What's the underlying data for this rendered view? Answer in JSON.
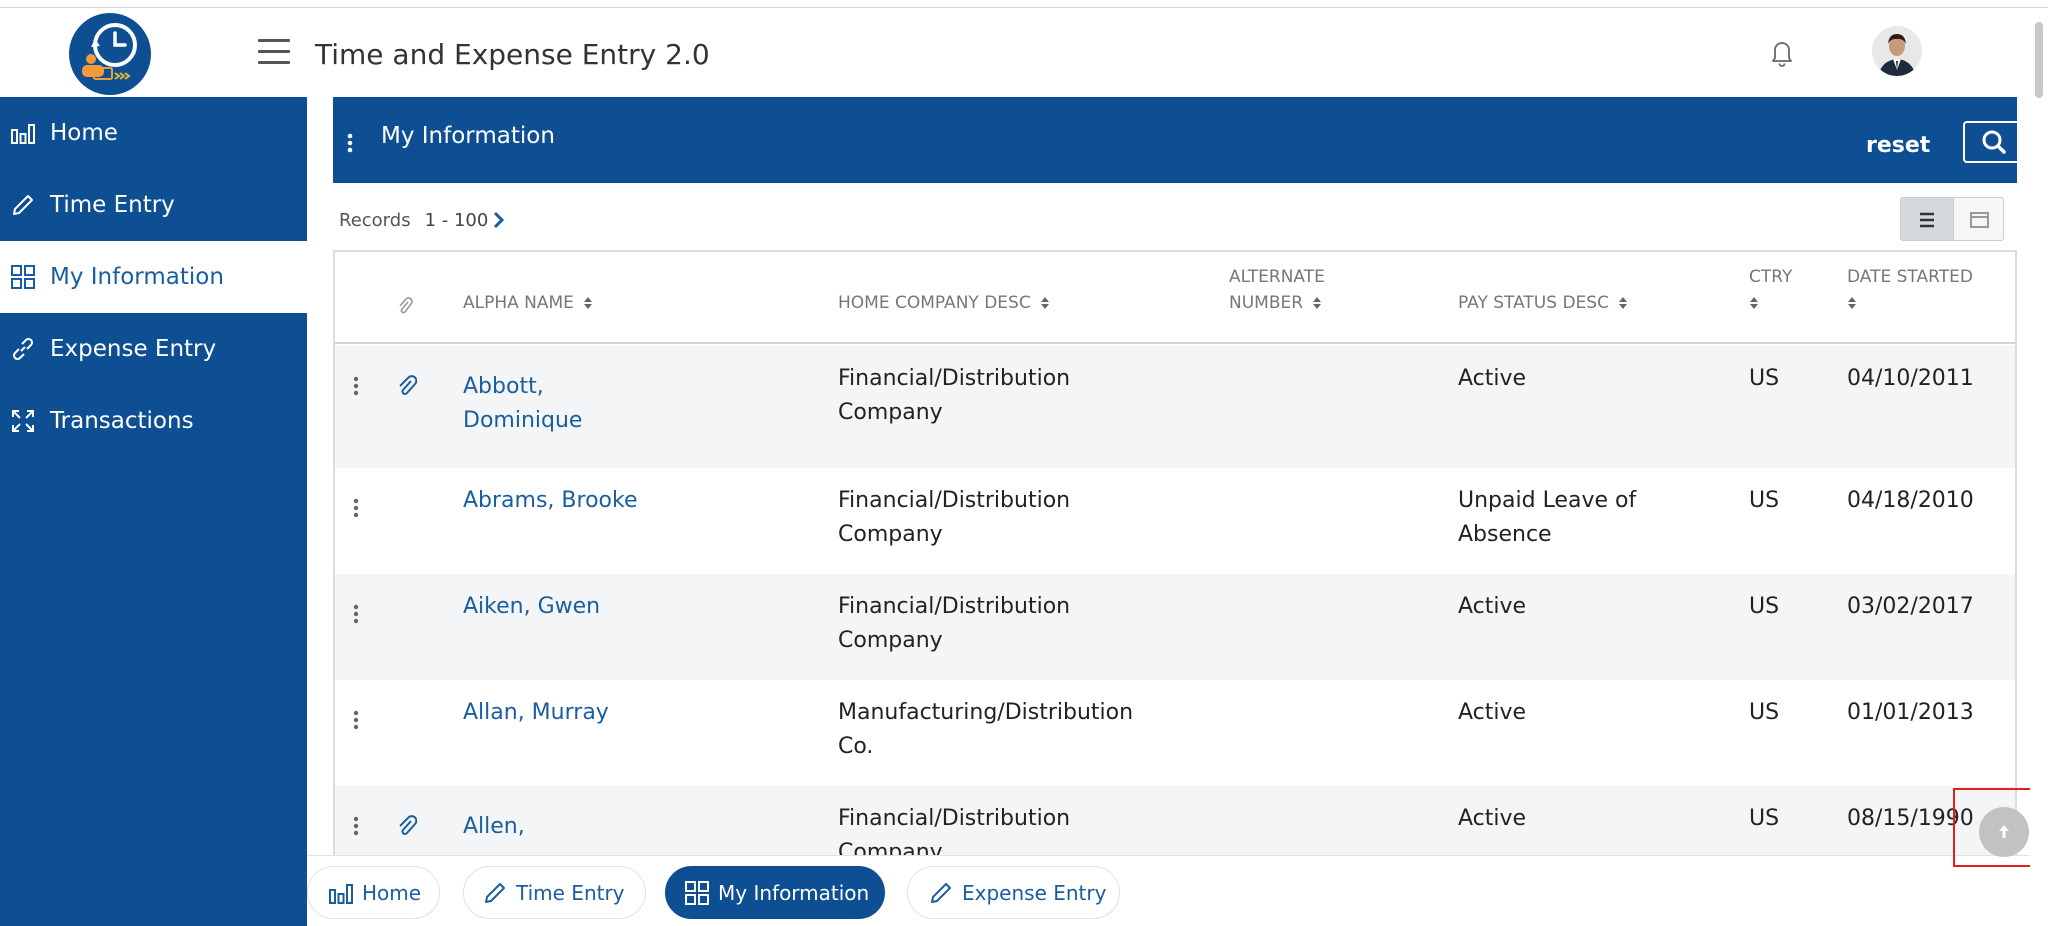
{
  "app": {
    "title": "Time and Expense Entry 2.0"
  },
  "sidebar": {
    "items": [
      {
        "label": "Home",
        "icon": "bar-chart-icon"
      },
      {
        "label": "Time Entry",
        "icon": "pencil-icon"
      },
      {
        "label": "My Information",
        "icon": "grid-icon",
        "active": true
      },
      {
        "label": "Expense Entry",
        "icon": "link-icon"
      },
      {
        "label": "Transactions",
        "icon": "expand-icon"
      }
    ]
  },
  "panel": {
    "title": "My Information",
    "reset_label": "reset",
    "records_label": "Records",
    "records_range": "1 - 100"
  },
  "table": {
    "columns": [
      "ALPHA NAME",
      "HOME COMPANY DESC",
      "ALTERNATE NUMBER",
      "PAY STATUS DESC",
      "CTRY",
      "DATE STARTED"
    ],
    "column_lines": {
      "alt_1": "ALTERNATE",
      "alt_2": "NUMBER"
    },
    "rows": [
      {
        "name_1": "Abbott,",
        "name_2": "Dominique",
        "company_1": "Financial/Distribution",
        "company_2": "Company",
        "alternate": "",
        "status_1": "Active",
        "status_2": "",
        "ctry": "US",
        "date": "04/10/2011",
        "attachment": true
      },
      {
        "name_1": "Abrams, Brooke",
        "name_2": "",
        "company_1": "Financial/Distribution",
        "company_2": "Company",
        "alternate": "",
        "status_1": "Unpaid Leave of",
        "status_2": "Absence",
        "ctry": "US",
        "date": "04/18/2010",
        "attachment": false
      },
      {
        "name_1": "Aiken, Gwen",
        "name_2": "",
        "company_1": "Financial/Distribution",
        "company_2": "Company",
        "alternate": "",
        "status_1": "Active",
        "status_2": "",
        "ctry": "US",
        "date": "03/02/2017",
        "attachment": false
      },
      {
        "name_1": "Allan, Murray",
        "name_2": "",
        "company_1": "Manufacturing/Distribution",
        "company_2": "Co.",
        "alternate": "",
        "status_1": "Active",
        "status_2": "",
        "ctry": "US",
        "date": "01/01/2013",
        "attachment": false
      },
      {
        "name_1": "Allen,",
        "name_2": "",
        "company_1": "Financial/Distribution",
        "company_2": "Company",
        "alternate": "",
        "status_1": "Active",
        "status_2": "",
        "ctry": "US",
        "date": "08/15/1990",
        "attachment": true
      }
    ]
  },
  "bottom_nav": {
    "items": [
      {
        "label": "Home",
        "icon": "bar-chart-icon"
      },
      {
        "label": "Time Entry",
        "icon": "pencil-icon"
      },
      {
        "label": "My Information",
        "icon": "grid-icon",
        "active": true
      },
      {
        "label": "Expense Entry",
        "icon": "pencil-icon"
      }
    ]
  },
  "colors": {
    "brand": "#0d4f92",
    "link": "#1a5ea0",
    "row_alt": "#f4f5f7",
    "highlight": "#e02020"
  }
}
